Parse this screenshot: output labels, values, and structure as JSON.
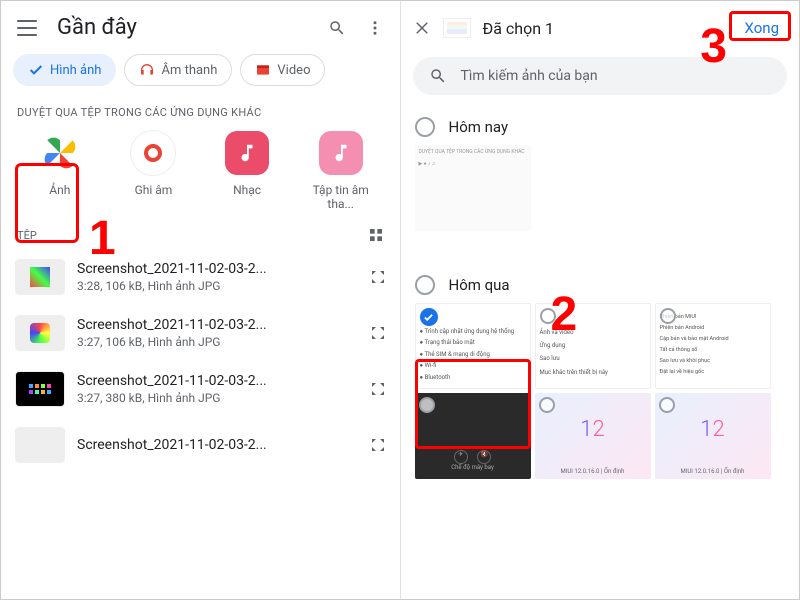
{
  "left": {
    "title": "Gần đây",
    "filters": {
      "images": "Hình ảnh",
      "audio": "Âm thanh",
      "video": "Video"
    },
    "apps_header": "DUYỆT QUA TỆP TRONG CÁC ỨNG DỤNG KHÁC",
    "apps": [
      {
        "label": "Ảnh"
      },
      {
        "label": "Ghi âm"
      },
      {
        "label": "Nhạc"
      },
      {
        "label": "Tập tin âm tha..."
      }
    ],
    "files_header": "TỆP",
    "files": [
      {
        "name": "Screenshot_2021-11-02-03-2...",
        "detail": "3:28, 106 kB, Hình ảnh JPG"
      },
      {
        "name": "Screenshot_2021-11-02-03-2...",
        "detail": "3:27, 106 kB, Hình ảnh JPG"
      },
      {
        "name": "Screenshot_2021-11-02-03-2...",
        "detail": "3:27, 380 kB, Hình ảnh JPG"
      },
      {
        "name": "Screenshot_2021-11-02-03-2...",
        "detail": ""
      }
    ]
  },
  "right": {
    "selected_title": "Đã chọn 1",
    "done": "Xong",
    "search_ph": "Tìm kiếm ảnh của bạn",
    "group_today": "Hôm nay",
    "group_yesterday": "Hôm qua",
    "selected_item_lines": {
      "l1": "Trình cập nhật ứng dụng hệ thống",
      "l2": "Trạng thái bảo mật",
      "l3": "Thẻ SIM & mạng di động",
      "l4": "Wi-fi",
      "l5": "Bluetooth"
    },
    "item2": {
      "l1": "Ảnh và video",
      "l2": "Ứng dụng",
      "l3": "Sao lưu",
      "l4": "Mục khác trên thiết bị này"
    },
    "item3": {
      "l0": "Phiên bản MIUI",
      "l1": "Phiên bản Android",
      "l2": "Cập bản và bảo mật Android",
      "l3": "Tất cả thông số",
      "l4": "Sao lưu và khôi phục",
      "l5": "Đặt lại về hiệu gốc"
    },
    "miui": "MIUI 12.0.16.0 | Ổn định",
    "dark_label": "Chế độ máy bay"
  },
  "annot": {
    "n1": "1",
    "n2": "2",
    "n3": "3"
  }
}
